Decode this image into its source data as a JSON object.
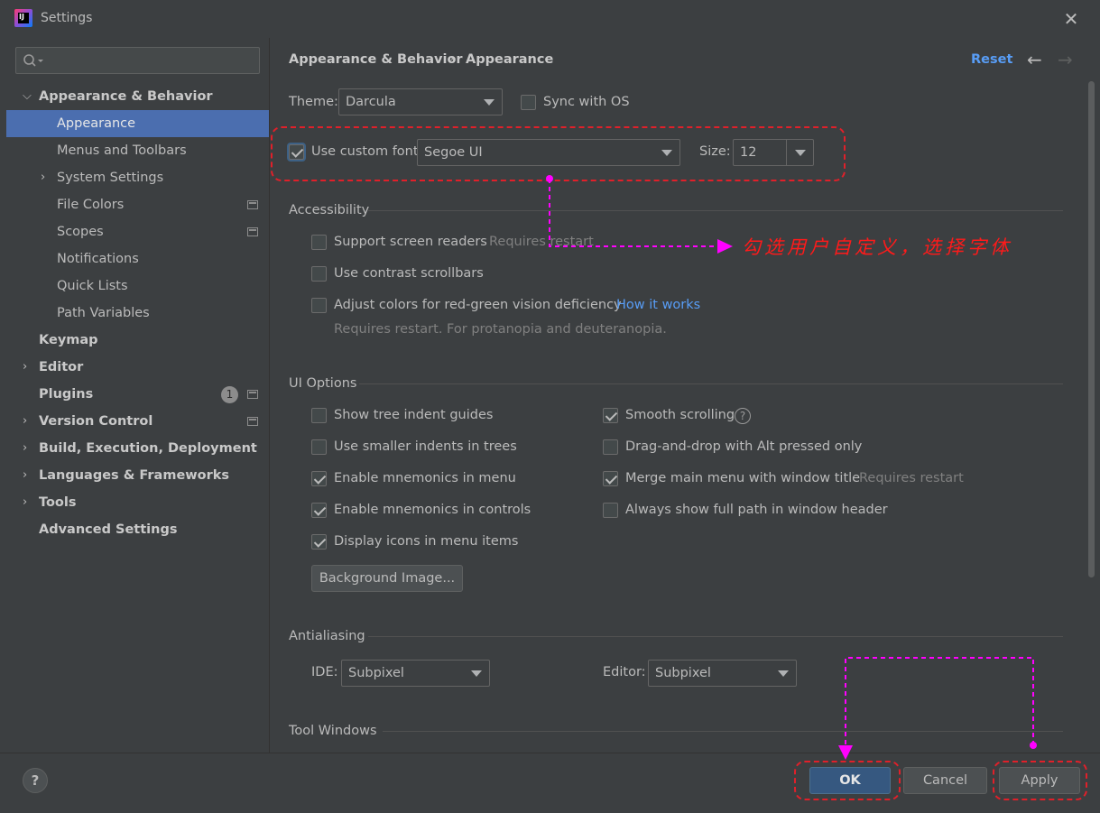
{
  "window": {
    "title": "Settings"
  },
  "sidebar": {
    "search": {
      "placeholder": ""
    },
    "items": [
      {
        "label": "Appearance & Behavior"
      },
      {
        "label": "Appearance"
      },
      {
        "label": "Menus and Toolbars"
      },
      {
        "label": "System Settings"
      },
      {
        "label": "File Colors"
      },
      {
        "label": "Scopes"
      },
      {
        "label": "Notifications"
      },
      {
        "label": "Quick Lists"
      },
      {
        "label": "Path Variables"
      },
      {
        "label": "Keymap"
      },
      {
        "label": "Editor"
      },
      {
        "label": "Plugins",
        "badge": "1"
      },
      {
        "label": "Version Control"
      },
      {
        "label": "Build, Execution, Deployment"
      },
      {
        "label": "Languages & Frameworks"
      },
      {
        "label": "Tools"
      },
      {
        "label": "Advanced Settings"
      }
    ]
  },
  "header": {
    "breadcrumb_parent": "Appearance & Behavior",
    "breadcrumb_sep": "›",
    "breadcrumb_current": "Appearance",
    "reset_label": "Reset"
  },
  "theme": {
    "label": "Theme:",
    "value": "Darcula",
    "sync_label": "Sync with OS"
  },
  "font": {
    "checkbox_label": "Use custom font:",
    "value": "Segoe UI",
    "size_label": "Size:",
    "size_value": "12"
  },
  "accessibility": {
    "title": "Accessibility",
    "screen_readers": "Support screen readers",
    "screen_readers_note": "Requires restart",
    "contrast_scrollbars": "Use contrast scrollbars",
    "red_green": "Adjust colors for red-green vision deficiency",
    "how_it_works": "How it works",
    "red_green_note": "Requires restart. For protanopia and deuteranopia."
  },
  "ui_options": {
    "title": "UI Options",
    "tree_indent": "Show tree indent guides",
    "smaller_indents": "Use smaller indents in trees",
    "mnemonics_menu": "Enable mnemonics in menu",
    "mnemonics_controls": "Enable mnemonics in controls",
    "icons_menu": "Display icons in menu items",
    "background_image": "Background Image...",
    "smooth_scrolling": "Smooth scrolling",
    "drag_drop": "Drag-and-drop with Alt pressed only",
    "merge_menu": "Merge main menu with window title",
    "merge_note": "Requires restart",
    "full_path": "Always show full path in window header"
  },
  "antialiasing": {
    "title": "Antialiasing",
    "ide_label": "IDE:",
    "ide_value": "Subpixel",
    "editor_label": "Editor:",
    "editor_value": "Subpixel"
  },
  "tool_windows": {
    "title": "Tool Windows"
  },
  "footer": {
    "help": "?",
    "ok": "OK",
    "cancel": "Cancel",
    "apply": "Apply"
  },
  "annotation": {
    "text": "勾选用户自定义，选择字体",
    "color": "#ff00ff"
  },
  "colors": {
    "accent": "#4b6eaf",
    "link": "#589df6",
    "annotation_box": "#e0202a",
    "annotation_arrow": "#ff00ff"
  }
}
